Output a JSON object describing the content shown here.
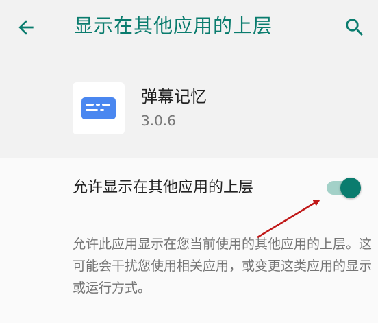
{
  "header": {
    "title": "显示在其他应用的上层",
    "back_icon": "arrow-back-icon",
    "search_icon": "search-icon"
  },
  "app": {
    "name": "弹幕记忆",
    "version": "3.0.6",
    "icon": "danmaku-app-icon"
  },
  "permission": {
    "switch_label": "允许显示在其他应用的上层",
    "enabled": true,
    "description": "允许此应用显示在您当前使用的其他应用的上层。这可能会干扰您使用相关应用，或变更这类应用的显示或运行方式。"
  },
  "colors": {
    "accent": "#0a7c6e",
    "toggle_track": "#a3d1c8",
    "app_icon_blue": "#4a87f0",
    "annotation": "#c01818"
  }
}
